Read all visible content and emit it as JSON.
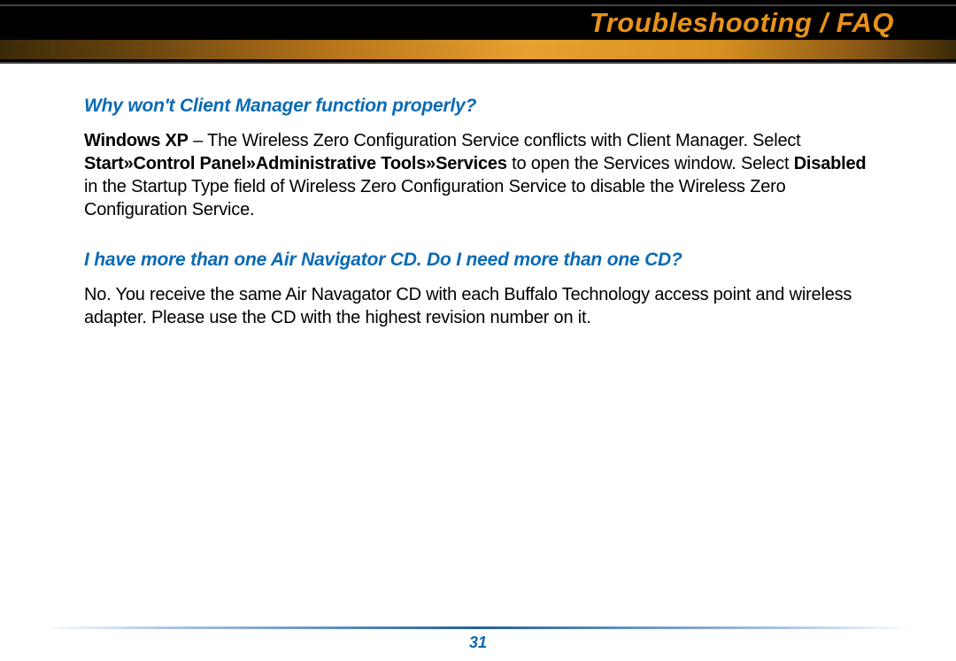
{
  "header": {
    "title": "Troubleshooting / FAQ"
  },
  "faq": [
    {
      "question": "Why won't Client Manager function properly?",
      "answer_parts": {
        "b1": "Windows XP",
        "t1": " – The Wireless Zero Configuration Service conflicts with Client Manager. Select ",
        "b2": "Start»Control Panel»Administrative Tools»Services",
        "t2": " to open the Services window. Select ",
        "b3": "Dis­abled",
        "t3": " in the Startup Type field of Wireless Zero Configuration Service to disable the Wireless Zero Configuration Service."
      }
    },
    {
      "question": "I have more than one Air Navigator CD. Do I need more than one CD?",
      "answer_parts": {
        "t1": "No. You receive the same Air Navagator CD with each Buffalo Technology access point and wire­less adapter. Please use the CD with the highest revision number on it."
      }
    }
  ],
  "footer": {
    "page_number": "31"
  }
}
